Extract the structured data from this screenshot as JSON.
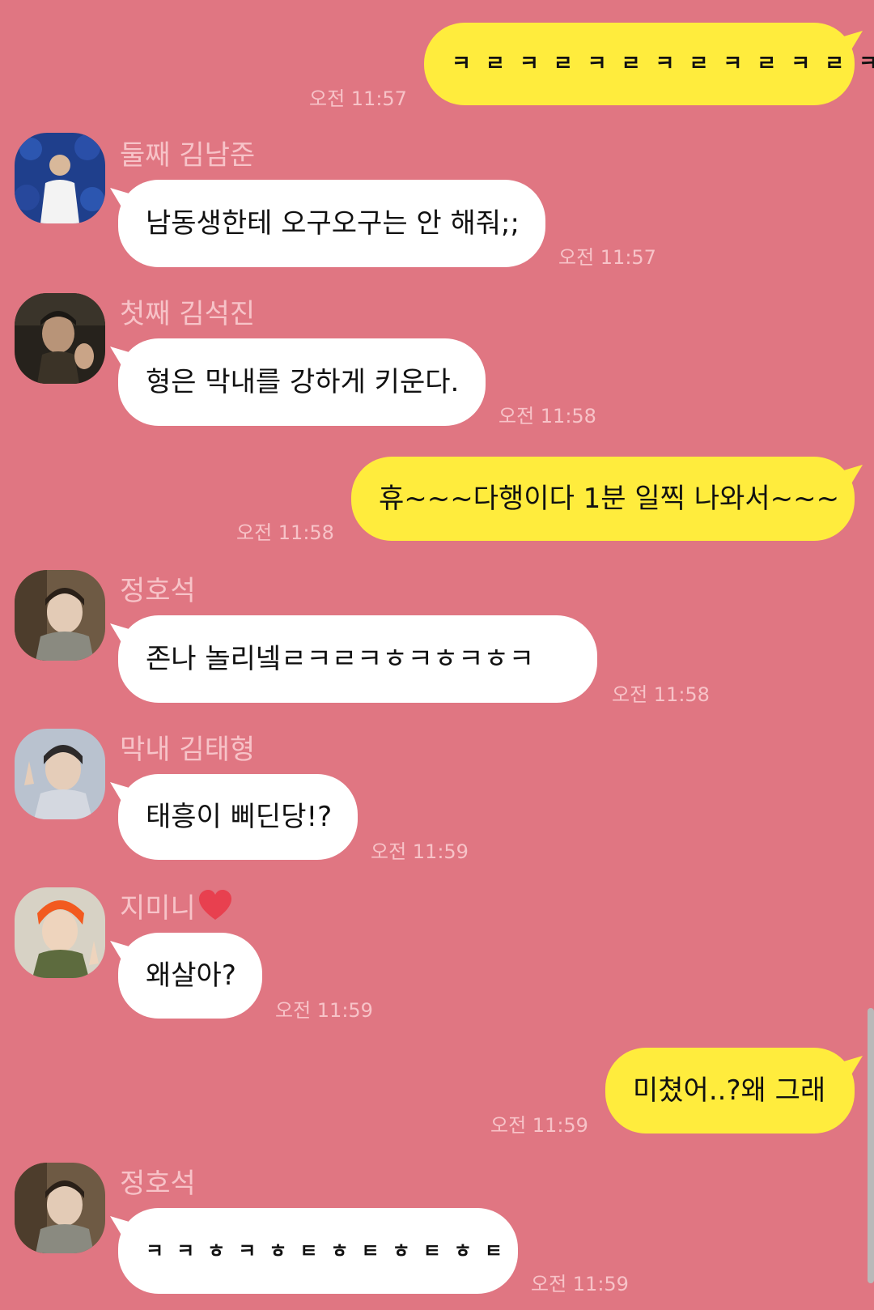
{
  "messages": [
    {
      "side": "out",
      "text": "ㅋㄹㅋㄹㅋㄹㅋㄹㅋㄹㅋㄹㅋ",
      "time": "오전 11:57"
    },
    {
      "side": "in",
      "sender": "둘째 김남준",
      "text": "남동생한테 오구오구는 안 해줘;;",
      "time": "오전 11:57"
    },
    {
      "side": "in",
      "sender": "첫째 김석진",
      "text": "형은 막내를 강하게 키운다.",
      "time": "오전 11:58"
    },
    {
      "side": "out",
      "text": "휴~~~다행이다 1분 일찍 나와서~~~",
      "time": "오전 11:58"
    },
    {
      "side": "in",
      "sender": "정호석",
      "text": "존나 놀리넼ㄹㅋㄹㅋㅎㅋㅎㅋㅎㅋ",
      "time": "오전 11:58"
    },
    {
      "side": "in",
      "sender": "막내 김태형",
      "text": "태흥이 삐딘당!?",
      "time": "오전 11:59"
    },
    {
      "side": "in",
      "sender": "지미니",
      "text": "왜살아?",
      "time": "오전 11:59"
    },
    {
      "side": "out",
      "text": "미쳤어..?왜 그래",
      "time": "오전 11:59"
    },
    {
      "side": "in",
      "sender": "정호석",
      "text": "ㅋㅋㅎㅋㅎㅌㅎㅌㅎㅌㅎㅌ",
      "time": "오전 11:59"
    }
  ],
  "colors": {
    "background": "#e07682",
    "incoming_bubble": "#ffffff",
    "outgoing_bubble": "#ffec3d",
    "meta_text": "#f7c3c8",
    "heart": "#e8404f"
  },
  "icons": {
    "sender_heart": "heart-icon"
  }
}
